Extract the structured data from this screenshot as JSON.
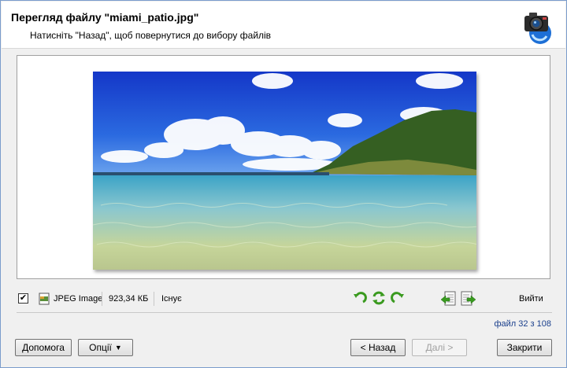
{
  "header": {
    "title": "Перегляд файлу \"miami_patio.jpg\"",
    "subtitle": "Натисніть \"Назад\", щоб повернутися до вибору файлів",
    "logo_icon": "camera-recovery-icon"
  },
  "preview": {
    "image_icon": "beach-photo",
    "colors": {
      "sky": "#1f4fd0",
      "sea": "#6fb6c8",
      "island": "#3d6b2a"
    }
  },
  "infobar": {
    "checked": "✔",
    "file_type": "JPEG Image",
    "file_size": "923,34 КБ",
    "file_status": "Існує",
    "rotate_left_icon": "rotate-left-icon",
    "flip_icon": "flip-icon",
    "rotate_right_icon": "rotate-right-icon",
    "prev_file_icon": "previous-file-icon",
    "next_file_icon": "next-file-icon",
    "exit_label": "Вийти"
  },
  "counter": "файл 32 з 108",
  "buttons": {
    "help": "Допомога",
    "options": "Опції",
    "back": "< Назад",
    "next": "Далі >",
    "close": "Закрити"
  }
}
